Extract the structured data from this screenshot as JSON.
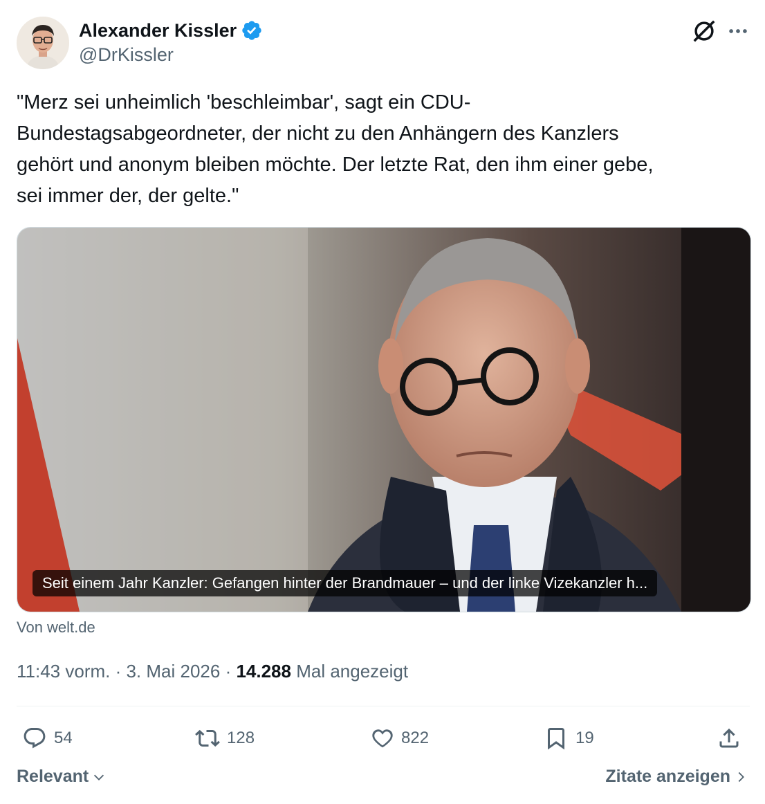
{
  "author": {
    "name": "Alexander Kissler",
    "handle": "@DrKissler",
    "verified_color": "#1d9bf0"
  },
  "tweet": {
    "text": "\"Merz sei unheimlich 'beschleimbar', sagt ein CDU-\nBundestagsabgeordneter, der nicht zu den Anhängern des Kanzlers\ngehört und anonym bleiben möchte. Der letzte Rat, den ihm einer gebe,\nsei immer der, der gelte.\""
  },
  "card": {
    "caption": "Seit einem Jahr Kanzler: Gefangen hinter der Brandmauer – und der linke Vizekanzler h...",
    "source": "Von welt.de"
  },
  "meta": {
    "time": "11:43 vorm.",
    "date": "3. Mai 2026",
    "views_count": "14.288",
    "views_label": "Mal angezeigt"
  },
  "actions": {
    "replies": "54",
    "reposts": "128",
    "likes": "822",
    "bookmarks": "19"
  },
  "footer": {
    "sort_label": "Relevant",
    "quotes_label": "Zitate anzeigen"
  },
  "icons": [
    "grok-icon",
    "more-icon",
    "verified-badge-icon",
    "reply-icon",
    "repost-icon",
    "like-icon",
    "bookmark-icon",
    "share-icon",
    "chevron-down-icon",
    "chevron-right-icon"
  ]
}
